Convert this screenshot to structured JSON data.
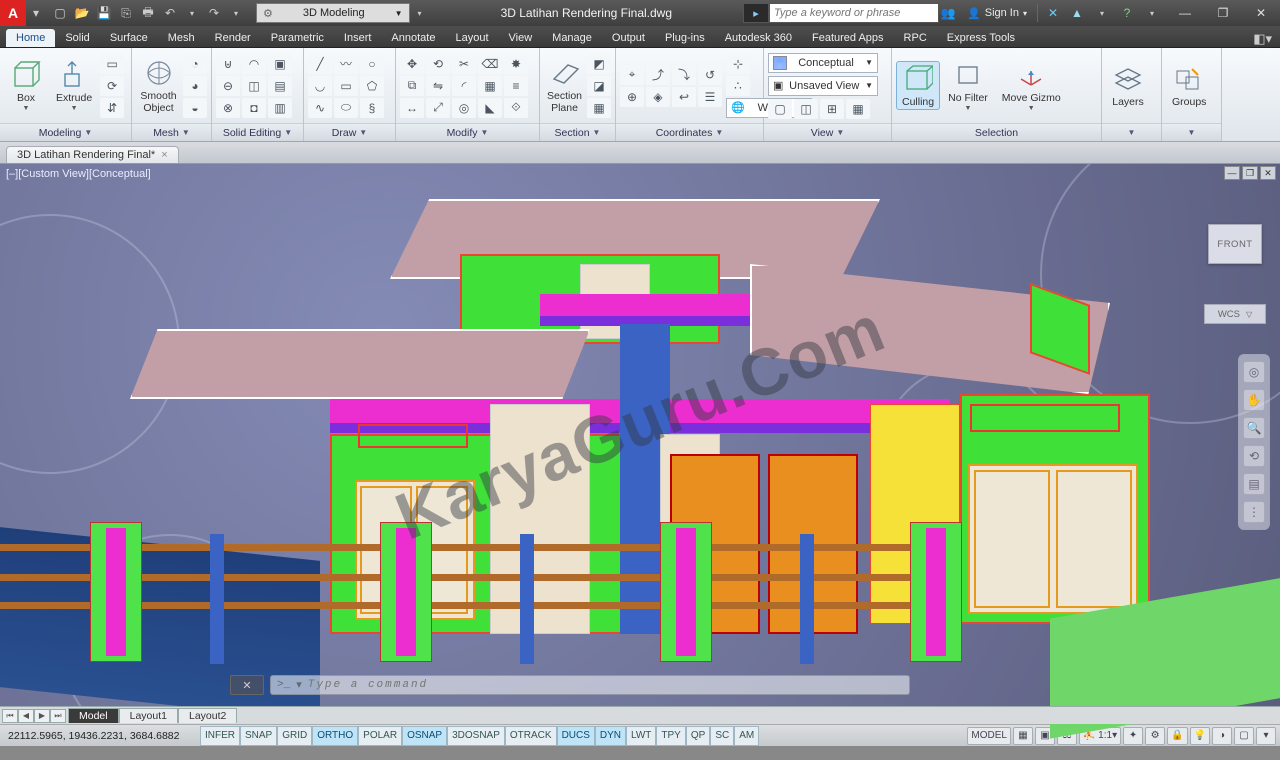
{
  "titlebar": {
    "workspace": "3D Modeling",
    "filename": "3D Latihan Rendering Final.dwg",
    "search_placeholder": "Type a keyword or phrase",
    "signin": "Sign In"
  },
  "ribbon_tabs": [
    "Home",
    "Solid",
    "Surface",
    "Mesh",
    "Render",
    "Parametric",
    "Insert",
    "Annotate",
    "Layout",
    "View",
    "Manage",
    "Output",
    "Plug-ins",
    "Autodesk 360",
    "Featured Apps",
    "RPC",
    "Express Tools"
  ],
  "ribbon_active": "Home",
  "panels": {
    "modeling": {
      "title": "Modeling",
      "box": "Box",
      "extrude": "Extrude"
    },
    "mesh": {
      "title": "Mesh",
      "smooth": "Smooth\nObject"
    },
    "solid_editing": {
      "title": "Solid Editing"
    },
    "draw": {
      "title": "Draw"
    },
    "modify": {
      "title": "Modify"
    },
    "section": {
      "title": "Section",
      "plane": "Section\nPlane"
    },
    "coordinates": {
      "title": "Coordinates",
      "world": "World"
    },
    "view": {
      "title": "View",
      "visual": "Conceptual",
      "saved": "Unsaved View"
    },
    "selection": {
      "title": "Selection",
      "culling": "Culling",
      "nofilter": "No Filter",
      "gizmo": "Move Gizmo"
    },
    "layers": {
      "title": "Layers",
      "btn": "Layers"
    },
    "groups": {
      "title": "Groups",
      "btn": "Groups"
    }
  },
  "doctab": "3D Latihan Rendering Final*",
  "viewport": {
    "label": "[–][Custom View][Conceptual]",
    "cube": "FRONT",
    "wcs": "WCS",
    "cmd_placeholder": "Type a command",
    "watermark": "KaryaGuru.Com"
  },
  "layout_tabs": [
    "Model",
    "Layout1",
    "Layout2"
  ],
  "layout_active": "Model",
  "status": {
    "coords": "22112.5965, 19436.2231, 3684.6882",
    "toggles": [
      "INFER",
      "SNAP",
      "GRID",
      "ORTHO",
      "POLAR",
      "OSNAP",
      "3DOSNAP",
      "OTRACK",
      "DUCS",
      "DYN",
      "LWT",
      "TPY",
      "QP",
      "SC",
      "AM"
    ],
    "toggles_on": [
      "ORTHO",
      "OSNAP",
      "DUCS",
      "DYN"
    ],
    "model_btn": "MODEL",
    "scale": "1:1"
  }
}
